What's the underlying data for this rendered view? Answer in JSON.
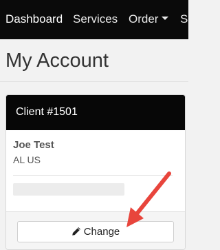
{
  "navbar": {
    "items": [
      {
        "label": "Dashboard"
      },
      {
        "label": "Services"
      },
      {
        "label": "Order"
      },
      {
        "label": "Su"
      }
    ]
  },
  "page": {
    "title": "My Account"
  },
  "card": {
    "header": "Client #1501",
    "client_name": "Joe Test",
    "client_location": "AL US",
    "change_label": "Change",
    "change_icon": "pencil-icon"
  },
  "annotation": {
    "arrow_color": "#e8453c"
  }
}
